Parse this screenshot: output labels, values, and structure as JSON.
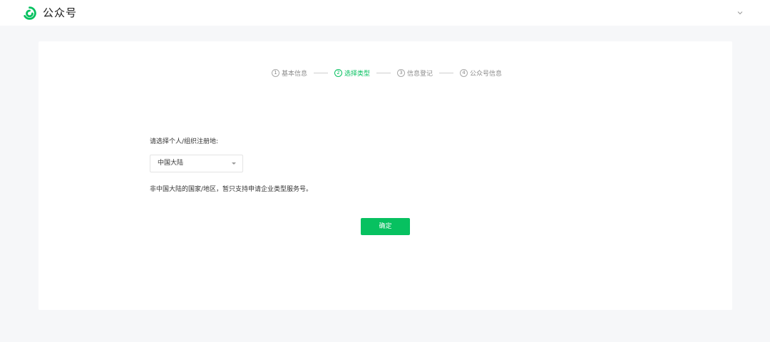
{
  "header": {
    "brand": "公众号",
    "colors": {
      "brand_green": "#07c160"
    },
    "account_toggle_icon": "chevron-down-icon"
  },
  "steps": [
    {
      "num": "1",
      "label": "基本信息",
      "active": false
    },
    {
      "num": "2",
      "label": "选择类型",
      "active": true
    },
    {
      "num": "3",
      "label": "信息登记",
      "active": false
    },
    {
      "num": "4",
      "label": "公众号信息",
      "active": false
    }
  ],
  "form": {
    "region_label": "请选择个人/组织注册地:",
    "region_value": "中国大陆",
    "hint": "非中国大陆的国家/地区，暂只支持申请企业类型服务号。",
    "confirm_label": "确定"
  }
}
